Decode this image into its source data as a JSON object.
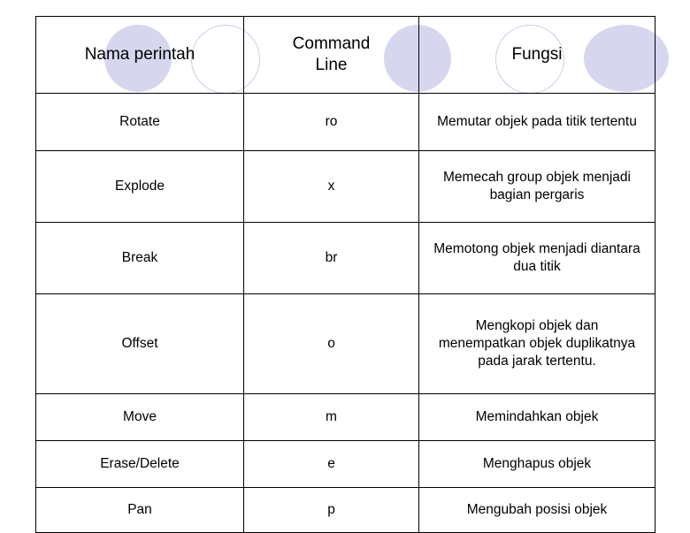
{
  "table": {
    "headers": [
      "Nama perintah",
      "Command Line",
      "Fungsi"
    ],
    "header_line1": [
      "Nama perintah",
      "Command",
      "Fungsi"
    ],
    "header_line2": "Line",
    "rows": [
      {
        "name": "Rotate",
        "command": "ro",
        "function": "Memutar objek pada titik tertentu"
      },
      {
        "name": "Explode",
        "command": "x",
        "function": "Memecah group objek menjadi bagian pergaris"
      },
      {
        "name": "Break",
        "command": "br",
        "function": "Memotong objek menjadi diantara dua titik"
      },
      {
        "name": "Offset",
        "command": "o",
        "function": "Mengkopi objek dan menempatkan objek duplikatnya pada jarak tertentu."
      },
      {
        "name": "Move",
        "command": "m",
        "function": "Memindahkan objek"
      },
      {
        "name": "Erase/Delete",
        "command": "e",
        "function": "Menghapus objek"
      },
      {
        "name": "Pan",
        "command": "p",
        "function": "Mengubah posisi objek"
      }
    ]
  },
  "decoration": {
    "filled_color": "#d6d7ef",
    "outline_color": "#c9cbe6"
  }
}
